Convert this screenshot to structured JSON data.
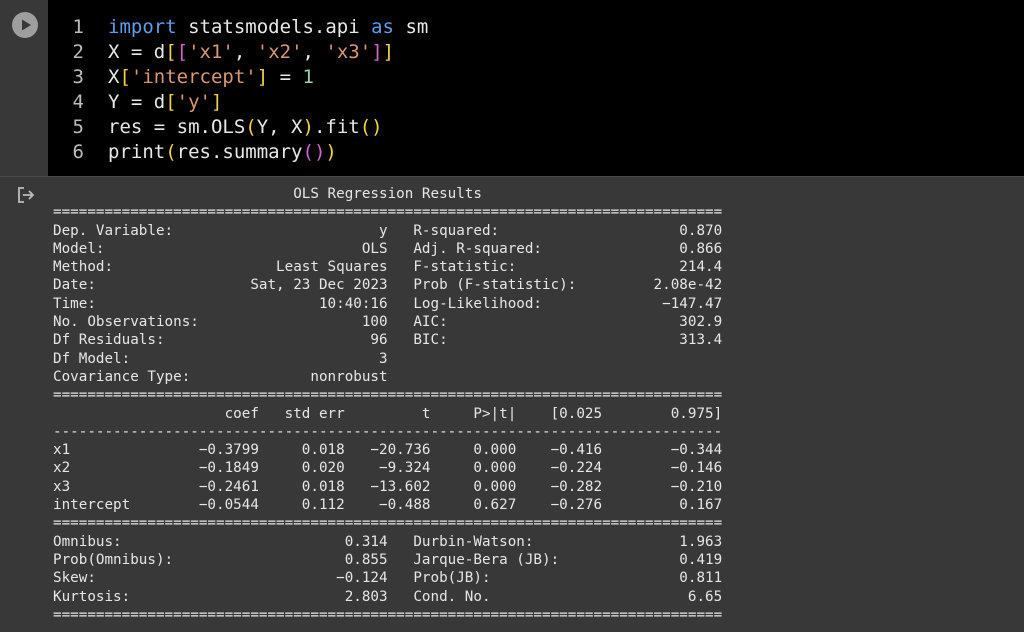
{
  "code_cell": {
    "run_button_icon": "play-icon",
    "lines": [
      {
        "num": "1",
        "parts": [
          {
            "t": "import",
            "c": "kw"
          },
          {
            "t": " statsmodels.api ",
            "c": ""
          },
          {
            "t": "as",
            "c": "kw"
          },
          {
            "t": " sm",
            "c": ""
          }
        ]
      },
      {
        "num": "2",
        "parts": [
          {
            "t": "X = d",
            "c": ""
          },
          {
            "t": "[",
            "c": "b1"
          },
          {
            "t": "[",
            "c": "b2"
          },
          {
            "t": "'x1'",
            "c": "str"
          },
          {
            "t": ", ",
            "c": ""
          },
          {
            "t": "'x2'",
            "c": "str"
          },
          {
            "t": ", ",
            "c": ""
          },
          {
            "t": "'x3'",
            "c": "str"
          },
          {
            "t": "]",
            "c": "b2"
          },
          {
            "t": "]",
            "c": "b1"
          }
        ]
      },
      {
        "num": "3",
        "parts": [
          {
            "t": "X",
            "c": ""
          },
          {
            "t": "[",
            "c": "b1"
          },
          {
            "t": "'intercept'",
            "c": "str"
          },
          {
            "t": "]",
            "c": "b1"
          },
          {
            "t": " = ",
            "c": ""
          },
          {
            "t": "1",
            "c": "num"
          }
        ]
      },
      {
        "num": "4",
        "parts": [
          {
            "t": "Y = d",
            "c": ""
          },
          {
            "t": "[",
            "c": "b1"
          },
          {
            "t": "'y'",
            "c": "str"
          },
          {
            "t": "]",
            "c": "b1"
          }
        ]
      },
      {
        "num": "5",
        "parts": [
          {
            "t": "res = sm.OLS",
            "c": ""
          },
          {
            "t": "(",
            "c": "b1"
          },
          {
            "t": "Y, X",
            "c": ""
          },
          {
            "t": ")",
            "c": "b1"
          },
          {
            "t": ".fit",
            "c": ""
          },
          {
            "t": "(",
            "c": "b1"
          },
          {
            "t": ")",
            "c": "b1"
          }
        ]
      },
      {
        "num": "6",
        "parts": [
          {
            "t": "print",
            "c": ""
          },
          {
            "t": "(",
            "c": "b1"
          },
          {
            "t": "res.summary",
            "c": ""
          },
          {
            "t": "(",
            "c": "b2"
          },
          {
            "t": ")",
            "c": "b2"
          },
          {
            "t": ")",
            "c": "b1"
          }
        ]
      }
    ]
  },
  "output": {
    "icon": "output-redirect-icon",
    "title": "OLS Regression Results",
    "top_info": [
      [
        "Dep. Variable:",
        "y",
        "R-squared:",
        "0.870"
      ],
      [
        "Model:",
        "OLS",
        "Adj. R-squared:",
        "0.866"
      ],
      [
        "Method:",
        "Least Squares",
        "F-statistic:",
        "214.4"
      ],
      [
        "Date:",
        "Sat, 23 Dec 2023",
        "Prob (F-statistic):",
        "2.08e-42"
      ],
      [
        "Time:",
        "10:40:16",
        "Log-Likelihood:",
        "-147.47"
      ],
      [
        "No. Observations:",
        "100",
        "AIC:",
        "302.9"
      ],
      [
        "Df Residuals:",
        "96",
        "BIC:",
        "313.4"
      ],
      [
        "Df Model:",
        "3",
        "",
        ""
      ],
      [
        "Covariance Type:",
        "nonrobust",
        "",
        ""
      ]
    ],
    "coef_headers": [
      "coef",
      "std err",
      "t",
      "P>|t|",
      "[0.025",
      "0.975]"
    ],
    "coef_rows": [
      [
        "x1",
        "-0.3799",
        "0.018",
        "-20.736",
        "0.000",
        "-0.416",
        "-0.344"
      ],
      [
        "x2",
        "-0.1849",
        "0.020",
        "-9.324",
        "0.000",
        "-0.224",
        "-0.146"
      ],
      [
        "x3",
        "-0.2461",
        "0.018",
        "-13.602",
        "0.000",
        "-0.282",
        "-0.210"
      ],
      [
        "intercept",
        "-0.0544",
        "0.112",
        "-0.488",
        "0.627",
        "-0.276",
        "0.167"
      ]
    ],
    "bottom_info": [
      [
        "Omnibus:",
        "0.314",
        "Durbin-Watson:",
        "1.963"
      ],
      [
        "Prob(Omnibus):",
        "0.855",
        "Jarque-Bera (JB):",
        "0.419"
      ],
      [
        "Skew:",
        "-0.124",
        "Prob(JB):",
        "0.811"
      ],
      [
        "Kurtosis:",
        "2.803",
        "Cond. No.",
        "6.65"
      ]
    ]
  }
}
